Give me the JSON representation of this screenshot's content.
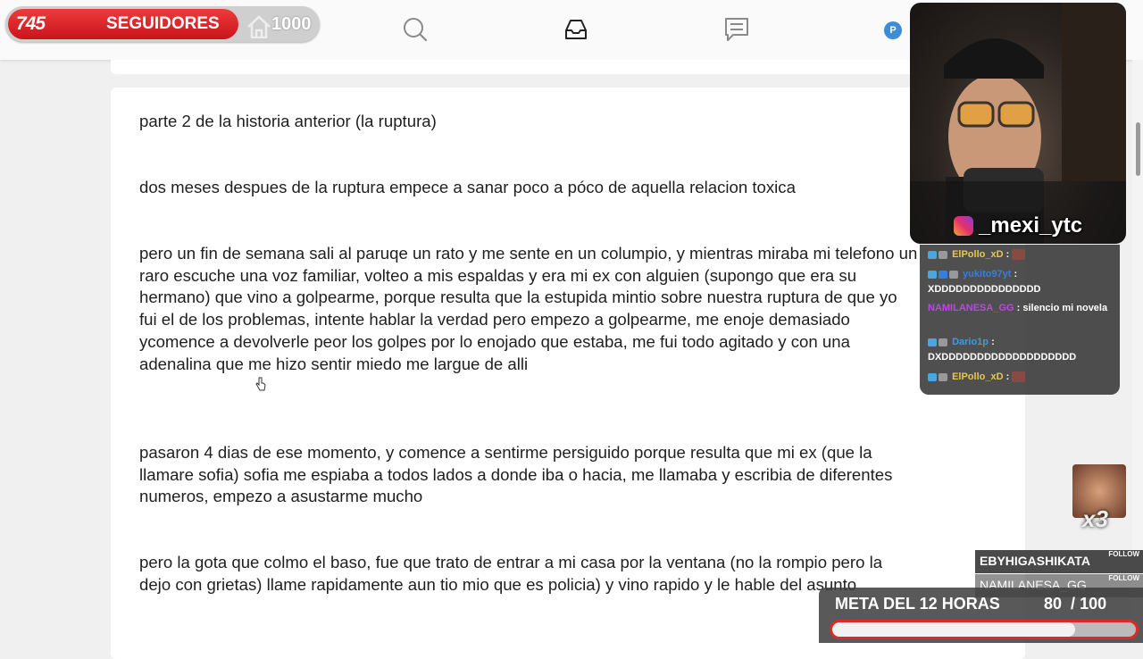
{
  "follow_widget": {
    "count": "745",
    "label": "SEGUIDORES",
    "goal": "1000",
    "progress": 0.745
  },
  "profile": {
    "initial": "P"
  },
  "post": {
    "paragraphs": [
      "parte 2 de la historia anterior (la ruptura)",
      "dos meses despues de la ruptura empece a sanar poco a póco de aquella relacion toxica",
      "pero un fin de semana sali al paruqe un rato y me sente en un columpio, y mientras miraba mi telefono un raro escuche una voz familiar, volteo a mis espaldas y era mi ex con alguien (supongo que era su hermano) que vino a golpearme, porque resulta que la estupida mintio sobre nuestra ruptura de que yo fui el de los problemas, intente hablar la verdad pero empezo a golpearme, me enoje  demasiado ycomence a devolverle peor los golpes por lo enojado que estaba, me fui todo agitado y con una adenalina que me hizo sentir miedo me largue de alli",
      "pasaron 4 dias de ese momento, y comence a sentirme persiguido porque resulta que mi ex (que la llamare sofia) sofia me espiaba a todos lados a donde iba o hacia, me llamaba y escribia de diferentes numeros, empezo a asustarme mucho",
      "pero la gota que colmo el baso, fue que trato de entrar a mi casa por la ventana (no la rompio pero la dejo con grietas) llame rapidamente aun tio mio que es policia) y vino rapido y le hable del asunto"
    ]
  },
  "stream": {
    "instagram_handle": "_mexi_ytc",
    "chat": [
      {
        "user": "ElPollo_xD",
        "user_color": "#e8c84a",
        "text": "",
        "has_emote": true
      },
      {
        "user": "yukito97yt",
        "user_color": "#3a7de0",
        "text": "XDDDDDDDDDDDDDDD",
        "has_emote": false
      },
      {
        "user": "NAMILANESA_GG",
        "user_color": "#b84ae0",
        "text": "silencio mi novela",
        "has_emote": false
      },
      {
        "user": "Dario1p",
        "user_color": "#3a9de0",
        "text": "DXDDDDDDDDDDDDDDDDDDD",
        "has_emote": false
      },
      {
        "user": "ElPollo_xD",
        "user_color": "#e8c84a",
        "text": "",
        "has_emote": true
      }
    ],
    "reaction_multiplier": "x3",
    "recent_followers": [
      {
        "name": "EBYHIGASHIKATA",
        "button": "FOLLOW"
      },
      {
        "name": "NAMILANESA_GG",
        "button": "FOLLOW"
      }
    ],
    "goal": {
      "label": "META DEL 12 HORAS",
      "current": "80",
      "separator": "/",
      "target": "100",
      "progress": 0.8
    }
  }
}
